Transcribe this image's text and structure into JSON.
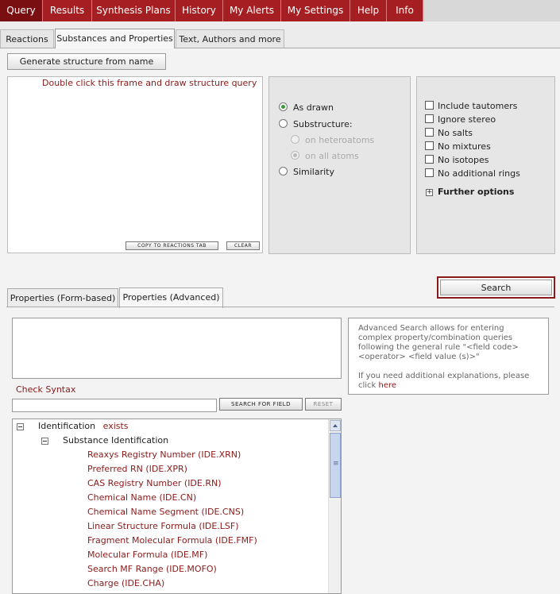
{
  "topnav": {
    "items": [
      {
        "label": "Query",
        "active": true
      },
      {
        "label": "Results"
      },
      {
        "label": "Synthesis Plans"
      },
      {
        "label": "History"
      },
      {
        "label": "My Alerts"
      },
      {
        "label": "My Settings"
      },
      {
        "label": "Help"
      },
      {
        "label": "Info"
      }
    ]
  },
  "subtabs": [
    {
      "label": "Reactions"
    },
    {
      "label": "Substances and Properties",
      "active": true
    },
    {
      "label": "Text, Authors and more"
    }
  ],
  "structure": {
    "generate_button": "Generate structure from name",
    "draw_hint": "Double click this frame and draw structure query",
    "copy_button": "COPY TO REACTIONS TAB",
    "clear_button": "CLEAR"
  },
  "search_mode": {
    "as_drawn": "As drawn",
    "substructure": "Substructure:",
    "on_heteroatoms": "on heteroatoms",
    "on_all_atoms": "on all atoms",
    "similarity": "Similarity"
  },
  "options": {
    "checkboxes": [
      "Include tautomers",
      "Ignore stereo",
      "No salts",
      "No mixtures",
      "No isotopes",
      "No additional rings"
    ],
    "further_options": "Further options"
  },
  "search_button": "Search",
  "property_tabs": [
    {
      "label": "Properties (Form-based)"
    },
    {
      "label": "Properties (Advanced)",
      "active": true
    }
  ],
  "advanced": {
    "check_syntax": "Check Syntax",
    "search_for_field": "SEARCH FOR FIELD",
    "reset": "RESET",
    "info_text": "Advanced Search allows for entering complex property/combination queries following the general rule \"<field code> <operator> <field value (s)>\"",
    "info_more": "If you need additional explanations, please click",
    "info_link": "here"
  },
  "tree": {
    "root_label": "Identification",
    "root_exists": "exists",
    "child_label": "Substance Identification",
    "fields": [
      "Reaxys Registry Number (IDE.XRN)",
      "Preferred RN (IDE.XPR)",
      "CAS Registry Number (IDE.RN)",
      "Chemical Name (IDE.CN)",
      "Chemical Name Segment (IDE.CNS)",
      "Linear Structure Formula (IDE.LSF)",
      "Fragment Molecular Formula (IDE.FMF)",
      "Molecular Formula (IDE.MF)",
      "Search MF Range (IDE.MOFO)",
      "Charge (IDE.CHA)"
    ]
  }
}
